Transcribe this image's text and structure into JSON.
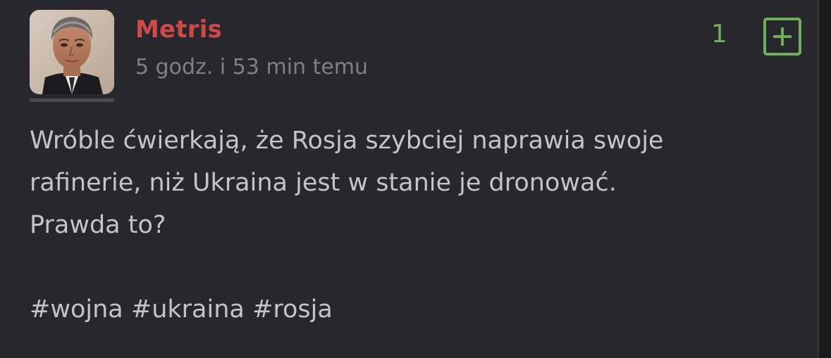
{
  "post": {
    "author": "Metris",
    "timestamp": "5 godz. i 53 min temu",
    "vote_count": "1",
    "content_lines": [
      "Wróble ćwierkają, że Rosja szybciej naprawia swoje",
      "rafinerie, niż Ukraina jest w stanie je dronować.",
      "Prawda to?"
    ],
    "tags": [
      "#wojna",
      "#ukraina",
      "#rosja"
    ]
  },
  "icons": {
    "vote": "plus-square-icon"
  },
  "colors": {
    "background": "#28272d",
    "author": "#cc4a47",
    "vote_accent": "#6fae5a",
    "text": "#c4c3c9",
    "muted": "#807f86"
  }
}
